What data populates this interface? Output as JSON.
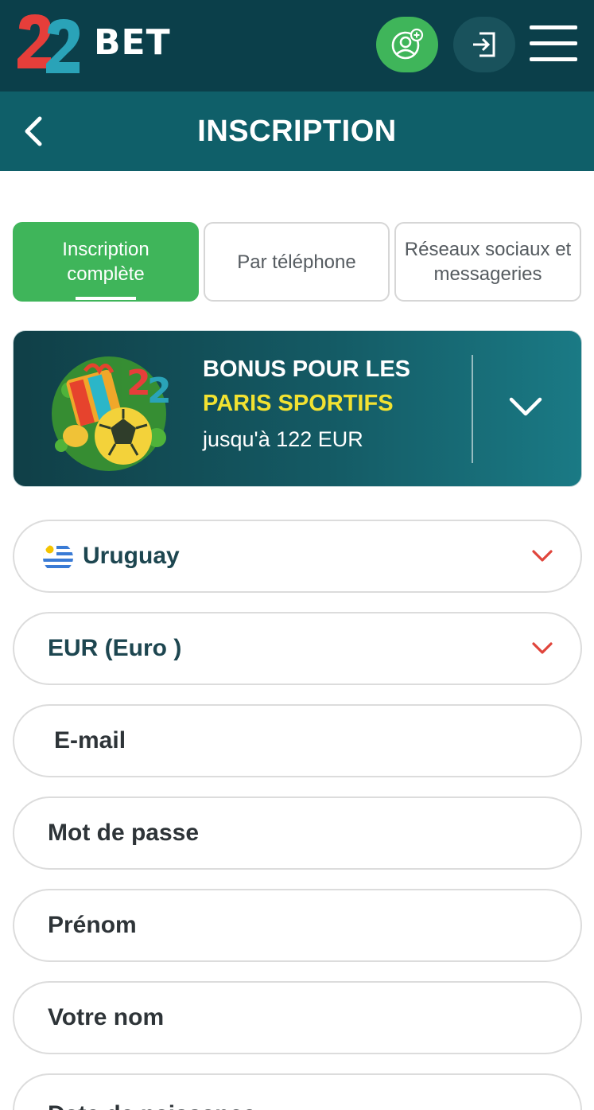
{
  "header": {
    "brand_prefix": "22",
    "brand_name": "BET",
    "icons": {
      "register": "user-plus-icon",
      "login": "login-icon",
      "menu": "hamburger-menu-icon"
    },
    "colors": {
      "bar": "#0b3f4a",
      "register_btn": "#3fb55a",
      "login_btn": "#19525c"
    }
  },
  "titlebar": {
    "title": "INSCRIPTION",
    "back_icon": "chevron-left-icon"
  },
  "tabs": [
    {
      "label": "Inscription complète",
      "active": true
    },
    {
      "label": "Par téléphone",
      "active": false
    },
    {
      "label": "Réseaux sociaux et messageries",
      "active": false
    }
  ],
  "bonus": {
    "line1": "BONUS POUR LES",
    "line2": "PARIS SPORTIFS",
    "line3": "jusqu'à 122 EUR",
    "expand_icon": "chevron-down-icon"
  },
  "form": {
    "country": {
      "value": "Uruguay",
      "flag_icon": "uruguay-flag-icon"
    },
    "currency": {
      "value": "EUR (Euro )"
    },
    "email": {
      "placeholder": "E-mail"
    },
    "password": {
      "placeholder": "Mot de passe"
    },
    "first_name": {
      "placeholder": "Prénom"
    },
    "last_name": {
      "placeholder": "Votre nom"
    },
    "birth_date": {
      "placeholder": "Date de naissance"
    }
  }
}
